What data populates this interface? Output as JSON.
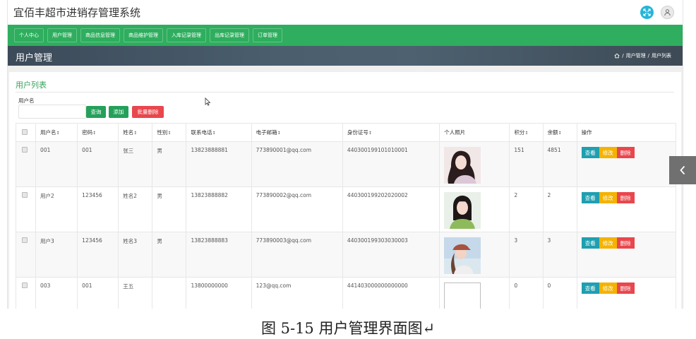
{
  "app": {
    "title": "宜佰丰超市进销存管理系统"
  },
  "nav": {
    "items": [
      {
        "label": "个人中心"
      },
      {
        "label": "用户管理"
      },
      {
        "label": "商品信息管理"
      },
      {
        "label": "商品维护管理"
      },
      {
        "label": "入库记录管理"
      },
      {
        "label": "出库记录管理"
      },
      {
        "label": "订单管理"
      }
    ]
  },
  "header": {
    "title": "用户管理",
    "breadcrumb": [
      "用户管理",
      "用户列表"
    ]
  },
  "panel": {
    "title": "用户列表"
  },
  "search": {
    "label": "用户名",
    "value": "",
    "query_label": "查询",
    "add_label": "添加",
    "batch_delete_label": "批量删除"
  },
  "table": {
    "columns": [
      "用户名",
      "密码",
      "姓名",
      "性别",
      "联系电话",
      "电子邮箱",
      "身份证号",
      "个人照片",
      "积分",
      "余额",
      "操作"
    ],
    "sortable": [
      true,
      true,
      true,
      true,
      true,
      true,
      true,
      false,
      true,
      true,
      false
    ],
    "rows": [
      {
        "username": "001",
        "password": "001",
        "name": "张三",
        "gender": "男",
        "phone": "13823888881",
        "email": "773890001@qq.com",
        "id_number": "440300199101010001",
        "photo": "photo-1",
        "points": "151",
        "balance": "4851"
      },
      {
        "username": "用户2",
        "password": "123456",
        "name": "姓名2",
        "gender": "男",
        "phone": "13823888882",
        "email": "773890002@qq.com",
        "id_number": "440300199202020002",
        "photo": "photo-2",
        "points": "2",
        "balance": "2"
      },
      {
        "username": "用户3",
        "password": "123456",
        "name": "姓名3",
        "gender": "男",
        "phone": "13823888883",
        "email": "773890003@qq.com",
        "id_number": "440300199303030003",
        "photo": "photo-3",
        "points": "3",
        "balance": "3"
      },
      {
        "username": "003",
        "password": "001",
        "name": "王五",
        "gender": "",
        "phone": "13800000000",
        "email": "123@qq.com",
        "id_number": "441403000000000000",
        "photo": "",
        "points": "0",
        "balance": "0"
      }
    ],
    "actions": {
      "view": "查看",
      "edit": "修改",
      "delete": "删除"
    }
  },
  "caption": "图 5-15 用户管理界面图↵",
  "colors": {
    "nav_bg": "#2eae5e",
    "header_bg": "#3c4a59",
    "title_green": "#37a35b",
    "btn_green": "#25a05a",
    "btn_red": "#e8474d",
    "btn_teal": "#1f9fb0",
    "btn_yellow": "#f4b300"
  }
}
